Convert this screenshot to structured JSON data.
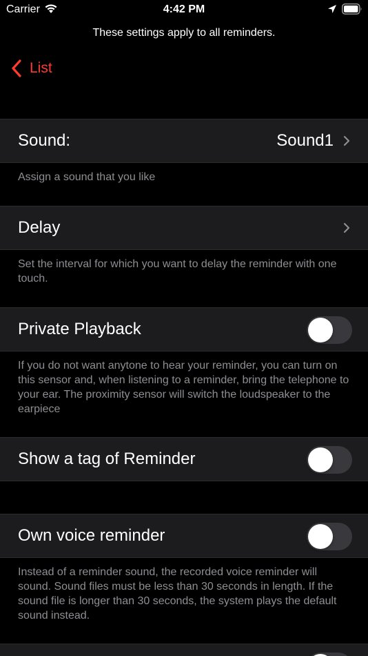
{
  "status_bar": {
    "carrier": "Carrier",
    "time": "4:42 PM"
  },
  "notice": "These settings apply to all reminders.",
  "nav": {
    "back_label": "List"
  },
  "colors": {
    "accent": "#ff3b30",
    "cell_bg": "#1c1c1e",
    "footer_text": "#8e8e93",
    "toggle_off": "#39393d"
  },
  "settings": {
    "sound": {
      "label": "Sound:",
      "value": "Sound1",
      "footer": "Assign a sound that you like"
    },
    "delay": {
      "label": "Delay",
      "footer": "Set the interval for which you want to delay the reminder with one touch."
    },
    "private_playback": {
      "label": "Private Playback",
      "enabled": false,
      "footer": "If you do not want anytone to hear your reminder, you can turn on this sensor and, when listening to a reminder, bring the telephone to your ear. The proximity sensor will switch the loudspeaker to the earpiece"
    },
    "show_tag": {
      "label": "Show a tag of Reminder",
      "enabled": false
    },
    "own_voice": {
      "label": "Own voice reminder",
      "enabled": false,
      "footer": "Instead of a reminder sound, the recorded voice reminder will sound. Sound files must be less than 30 seconds in length. If the sound file is longer than 30 seconds, the system plays the default sound instead."
    }
  }
}
